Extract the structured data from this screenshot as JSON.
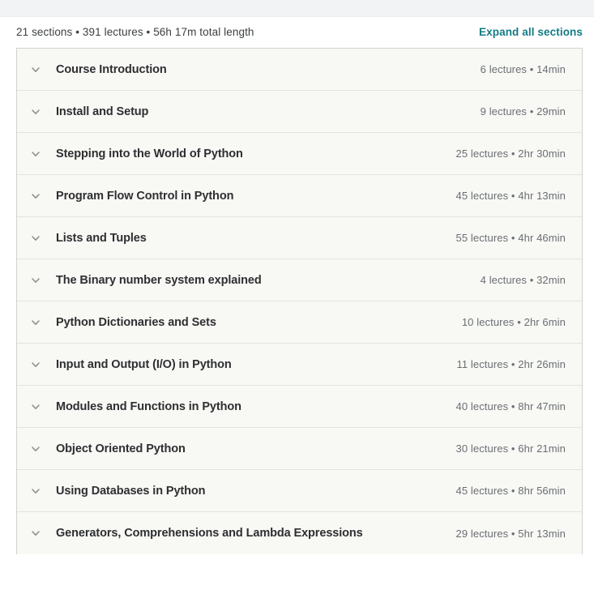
{
  "header": {
    "summary": "21 sections • 391 lectures • 56h 17m total length",
    "expand_all_label": "Expand all sections",
    "accent_color": "#157b84"
  },
  "icons": {
    "chevron": "chevron-down-icon"
  },
  "sections": [
    {
      "title": "Course Introduction",
      "meta": "6 lectures • 14min"
    },
    {
      "title": "Install and Setup",
      "meta": "9 lectures • 29min"
    },
    {
      "title": "Stepping into the World of Python",
      "meta": "25 lectures • 2hr 30min"
    },
    {
      "title": "Program Flow Control in Python",
      "meta": "45 lectures • 4hr 13min"
    },
    {
      "title": "Lists and Tuples",
      "meta": "55 lectures • 4hr 46min"
    },
    {
      "title": "The Binary number system explained",
      "meta": "4 lectures • 32min"
    },
    {
      "title": "Python Dictionaries and Sets",
      "meta": "10 lectures • 2hr 6min"
    },
    {
      "title": "Input and Output (I/O) in Python",
      "meta": "11 lectures • 2hr 26min"
    },
    {
      "title": "Modules and Functions in Python",
      "meta": "40 lectures • 8hr 47min"
    },
    {
      "title": "Object Oriented Python",
      "meta": "30 lectures • 6hr 21min"
    },
    {
      "title": "Using Databases in Python",
      "meta": "45 lectures • 8hr 56min"
    },
    {
      "title": "Generators, Comprehensions and Lambda Expressions",
      "meta": "29 lectures • 5hr 13min"
    }
  ]
}
